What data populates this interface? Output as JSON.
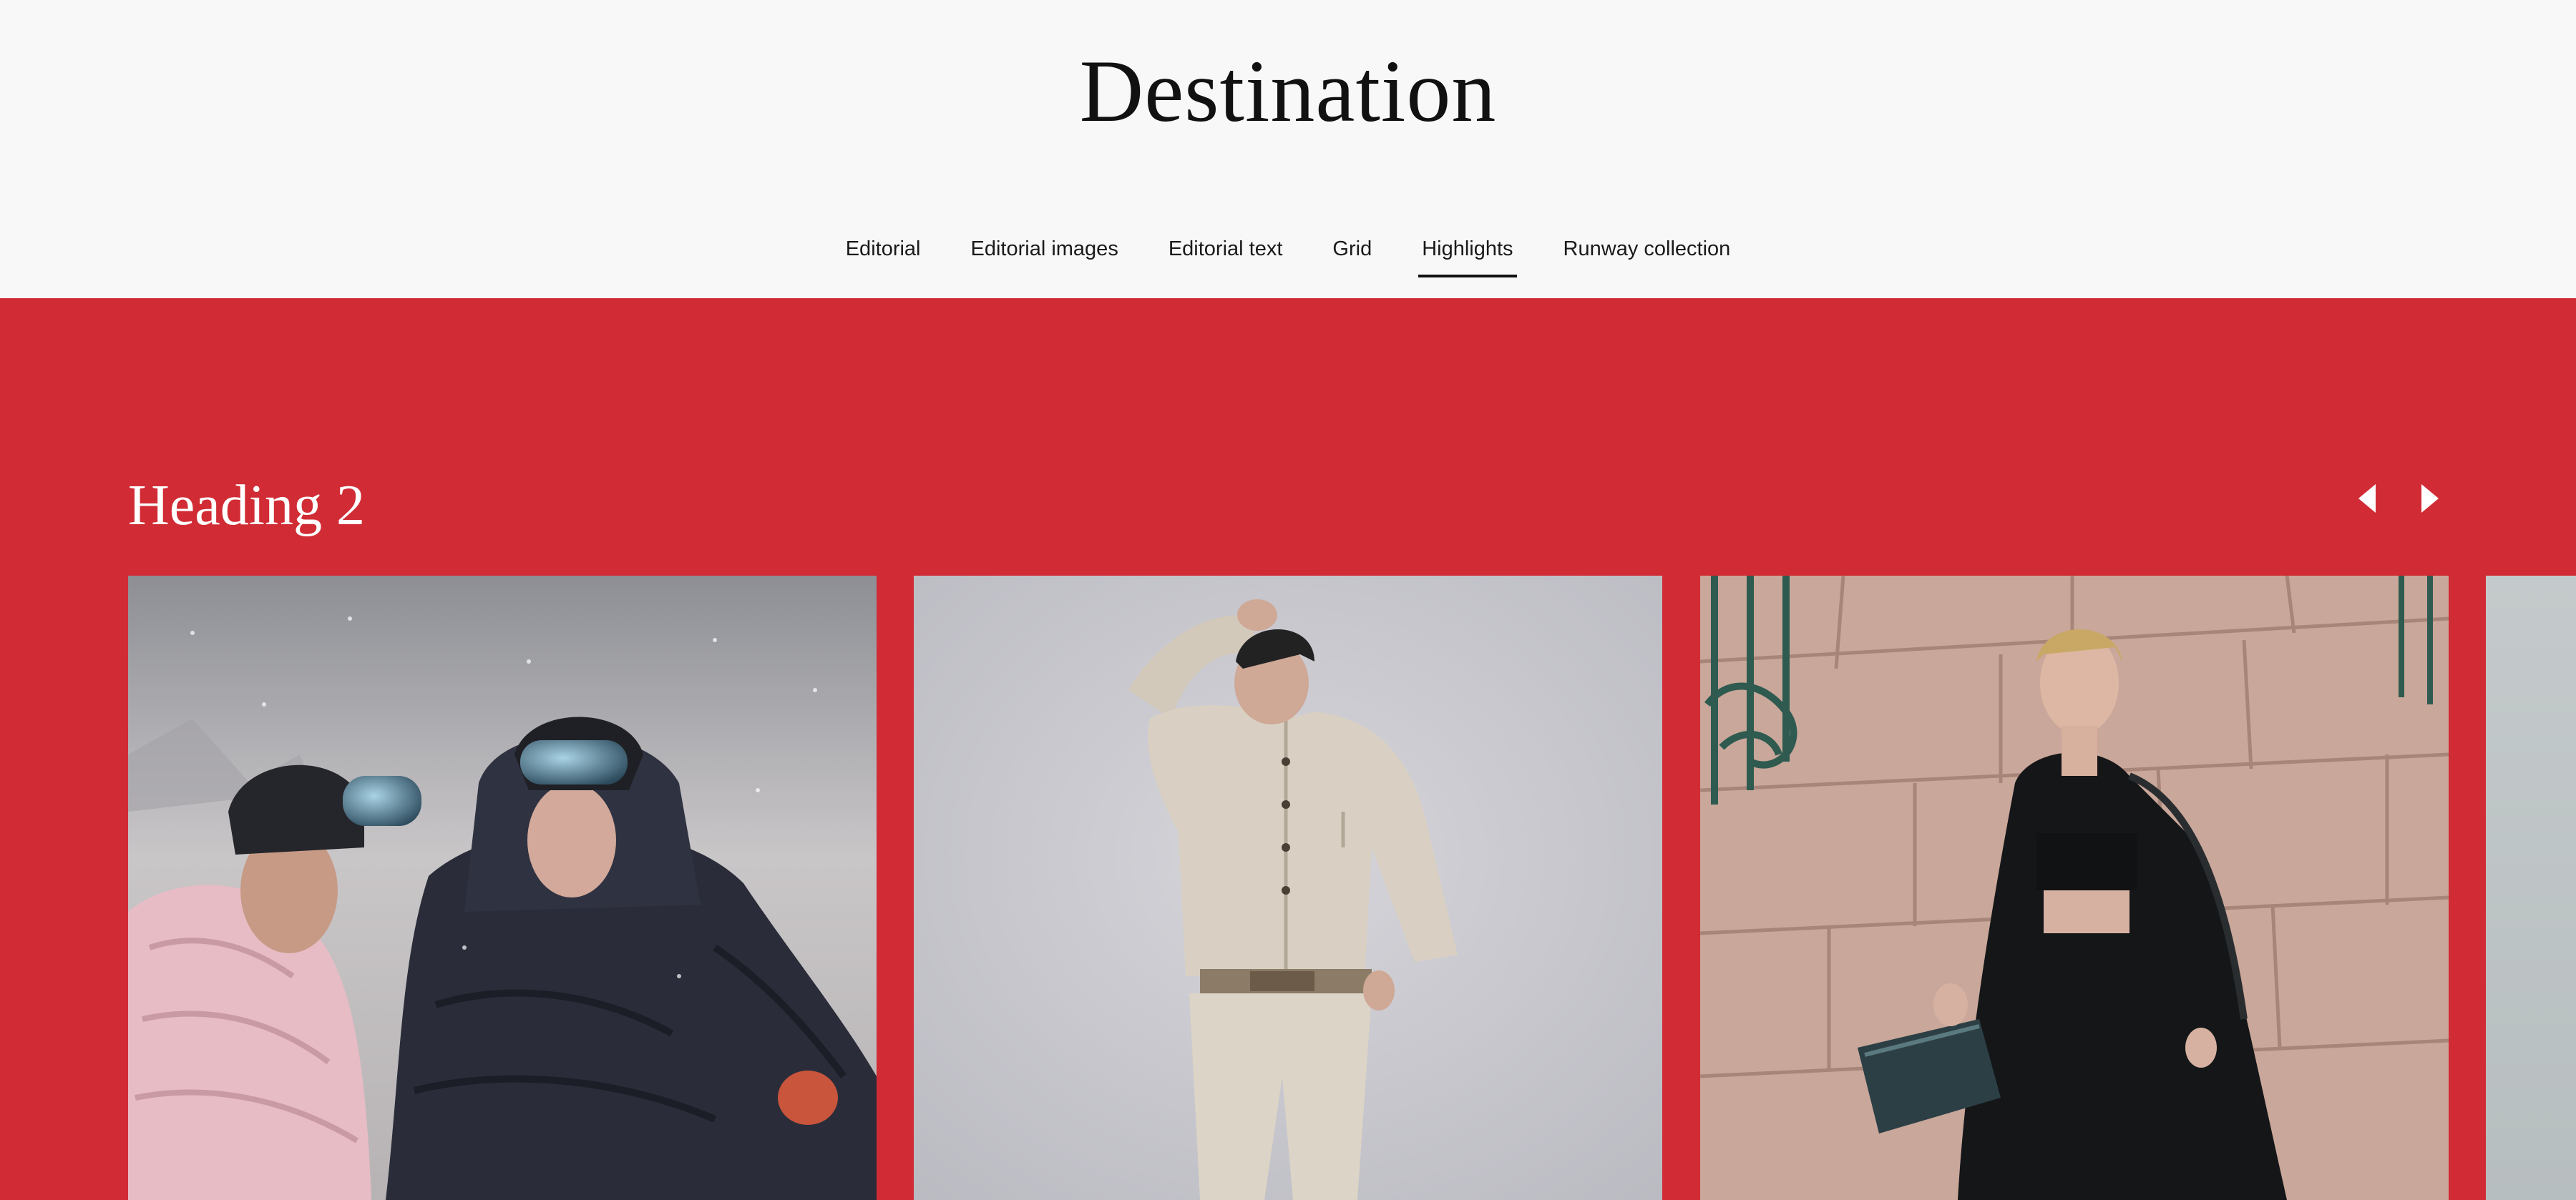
{
  "header": {
    "title": "Destination"
  },
  "nav": {
    "items": [
      {
        "label": "Editorial",
        "active": false
      },
      {
        "label": "Editorial images",
        "active": false
      },
      {
        "label": "Editorial text",
        "active": false
      },
      {
        "label": "Grid",
        "active": false
      },
      {
        "label": "Highlights",
        "active": true
      },
      {
        "label": "Runway collection",
        "active": false
      }
    ]
  },
  "highlights": {
    "heading": "Heading 2",
    "background_color": "#d12c35",
    "prev_icon": "triangle-left-icon",
    "next_icon": "triangle-right-icon",
    "cards": [
      {
        "image": "two-models-in-puffer-jackets-and-ski-helmets"
      },
      {
        "image": "model-in-cream-utility-jumpsuit"
      },
      {
        "image": "model-in-black-coat-against-stone-wall"
      },
      {
        "image": "partially-visible-fourth-image"
      }
    ]
  }
}
